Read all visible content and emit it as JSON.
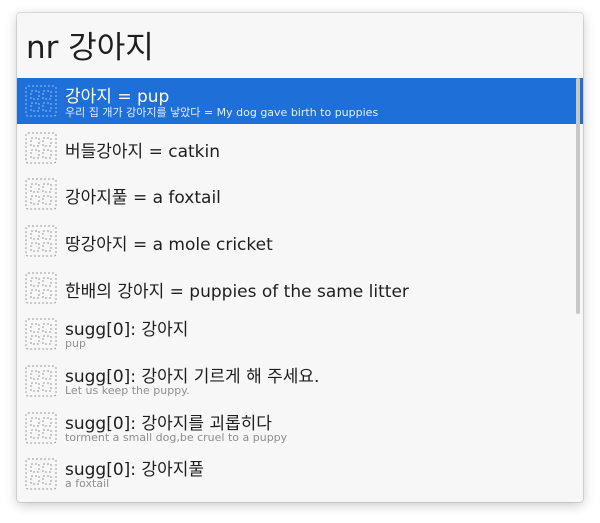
{
  "search": {
    "query": "nr 강아지"
  },
  "results": [
    {
      "title": "강아지 = pup",
      "subtitle": "우리 집 개가 강아지를 낳았다 = My dog gave birth to puppies",
      "icon": "grid-icon"
    },
    {
      "title": "버들강아지 = catkin",
      "subtitle": "",
      "icon": "grid-icon"
    },
    {
      "title": "강아지풀 = a foxtail",
      "subtitle": "",
      "icon": "grid-icon"
    },
    {
      "title": "땅강아지 = a mole cricket",
      "subtitle": "",
      "icon": "grid-icon"
    },
    {
      "title": "한배의 강아지 = puppies of the same litter",
      "subtitle": "",
      "icon": "grid-icon"
    },
    {
      "title": "sugg[0]: 강아지",
      "subtitle": "pup",
      "icon": "grid-icon"
    },
    {
      "title": "sugg[0]: 강아지 기르게 해 주세요.",
      "subtitle": "Let us keep the puppy.",
      "icon": "grid-icon"
    },
    {
      "title": "sugg[0]: 강아지를 괴롭히다",
      "subtitle": "torment a small dog,be cruel to a puppy",
      "icon": "grid-icon"
    },
    {
      "title": "sugg[0]: 강아지풀",
      "subtitle": "a foxtail",
      "icon": "grid-icon"
    }
  ],
  "colors": {
    "selected_row": "#1f6fd8",
    "panel_background": "#f7f7f7"
  }
}
